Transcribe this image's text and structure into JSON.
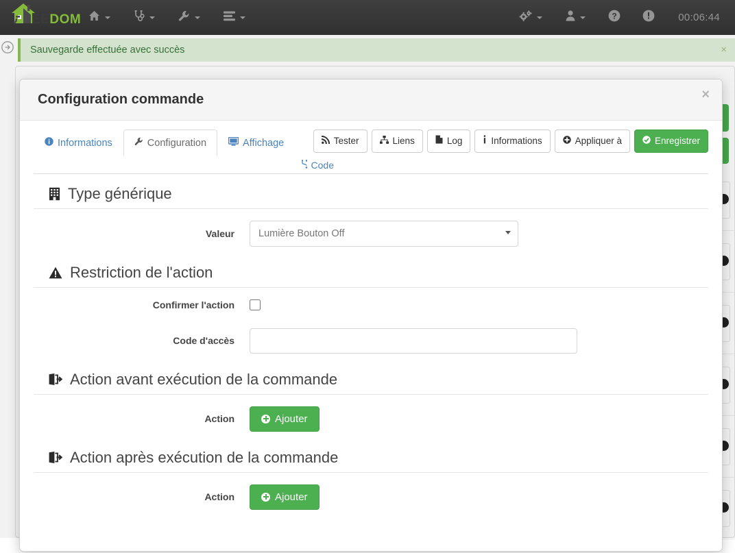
{
  "navbar": {
    "brand": {
      "ee": "EE",
      "dom": "DOM",
      "icon": "jeedom-house-logo"
    },
    "items": [
      {
        "label": "",
        "icon": "home-icon",
        "name": "nav-home"
      },
      {
        "label": "",
        "icon": "stethoscope-icon",
        "name": "nav-health"
      },
      {
        "label": "",
        "icon": "wrench-icon",
        "name": "nav-tools"
      },
      {
        "label": "",
        "icon": "server-list-icon",
        "name": "nav-plugins"
      }
    ],
    "right": [
      {
        "icon": "gears-icon",
        "name": "nav-settings"
      },
      {
        "icon": "user-icon",
        "name": "nav-user"
      },
      {
        "icon": "question-circle-icon",
        "name": "nav-help"
      },
      {
        "icon": "exclamation-circle-icon",
        "name": "nav-alerts"
      }
    ],
    "clock": "00:06:44"
  },
  "alert": {
    "message": "Sauvegarde effectuée avec succès",
    "close": "×",
    "bg_color": "#dff0d8",
    "text_color": "#3c763d",
    "border_color": "#8cc152"
  },
  "sidebar_toggle": {
    "icon": "arrow-circle-right-icon"
  },
  "modal": {
    "title": "Configuration commande",
    "close": "×",
    "tabs": [
      {
        "label": "Informations",
        "icon": "info-circle-icon",
        "active": false
      },
      {
        "label": "Configuration",
        "icon": "wrench-icon",
        "active": true
      },
      {
        "label": "Affichage",
        "icon": "desktop-icon",
        "active": false
      }
    ],
    "toolbar": [
      {
        "label": "Tester",
        "icon": "rss-icon",
        "style": "default"
      },
      {
        "label": "Liens",
        "icon": "sitemap-icon",
        "style": "default"
      },
      {
        "label": "Log",
        "icon": "file-icon",
        "style": "default"
      },
      {
        "label": "Informations",
        "icon": "info-icon",
        "style": "default"
      },
      {
        "label": "Appliquer à",
        "icon": "plus-circle-icon",
        "style": "default"
      },
      {
        "label": "Enregistrer",
        "icon": "check-circle-icon",
        "style": "success"
      }
    ],
    "code_link": {
      "label": "Code",
      "icon": "code-fork-icon"
    },
    "sections": [
      {
        "id": "type-generique",
        "title": "Type générique",
        "icon": "building-icon",
        "fields": [
          {
            "type": "select",
            "label": "Valeur",
            "value": "Lumière Bouton Off",
            "options": [
              "Lumière Bouton Off"
            ]
          }
        ]
      },
      {
        "id": "restriction-action",
        "title": "Restriction de l'action",
        "icon": "warning-triangle-icon",
        "fields": [
          {
            "type": "checkbox",
            "label": "Confirmer l'action",
            "checked": false
          },
          {
            "type": "text",
            "label": "Code d'accès",
            "value": "",
            "placeholder": ""
          }
        ]
      },
      {
        "id": "action-avant",
        "title": "Action avant exécution de la commande",
        "icon": "sign-out-icon",
        "fields": [
          {
            "type": "button",
            "label": "Action",
            "button_label": "Ajouter",
            "icon": "plus-circle-icon"
          }
        ]
      },
      {
        "id": "action-apres",
        "title": "Action après exécution de la commande",
        "icon": "sign-out-icon",
        "fields": [
          {
            "type": "button",
            "label": "Action",
            "button_label": "Ajouter",
            "icon": "plus-circle-icon"
          }
        ]
      }
    ]
  },
  "colors": {
    "navbar_bg": "#383838",
    "brand_green": "#8dc63f",
    "success_green": "#4caf50",
    "danger_red": "#e15f5a",
    "link_blue": "#4a83bd"
  }
}
